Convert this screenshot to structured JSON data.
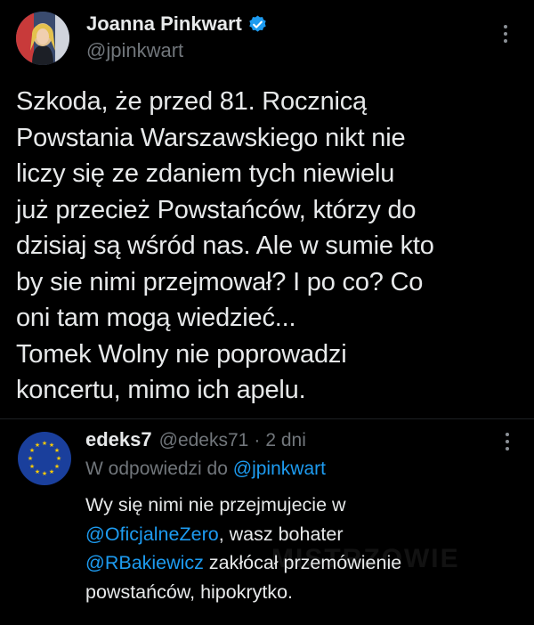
{
  "tweet": {
    "display_name": "Joanna Pinkwart",
    "handle": "@jpinkwart",
    "avatar_icon": "user-photo-avatar",
    "verified_icon": "verified-badge-icon",
    "more_icon": "more-options-icon",
    "text": "Szkoda, że przed 81. Rocznicą\nPowstania Warszawskiego nikt nie\nliczy się ze zdaniem tych niewielu\njuż przecież Powstańców, którzy do\ndzisiaj są wśród nas. Ale w sumie kto\nby sie nimi przejmował? I po co? Co\noni tam mogą wiedzieć...\nTomek Wolny nie poprowadzi\nkoncertu, mimo ich apelu."
  },
  "reply": {
    "display_name": "edeks7",
    "handle": "@edeks71",
    "separator": "·",
    "time": "2 dni",
    "avatar_icon": "eu-flag-avatar",
    "more_icon": "more-options-icon",
    "replying_prefix": "W odpowiedzi do ",
    "replying_mention": "@jpinkwart",
    "line1": "Wy się nimi nie przejmujecie w",
    "mention1": "@OficjalneZero",
    "line2_rest": ", wasz bohater",
    "mention2": "@RBakiewicz",
    "line3_rest": " zakłócał przemówienie",
    "line4": "powstańców, hipokrytko."
  },
  "watermark": {
    "text": "MISTRZOWIE"
  },
  "colors": {
    "background": "#000000",
    "text_primary": "#e7e9ea",
    "text_secondary": "#71767b",
    "link": "#1d9bf0",
    "verified": "#1d9bf0",
    "eu_blue": "#1a3f9c",
    "eu_star": "#ffcc00"
  }
}
